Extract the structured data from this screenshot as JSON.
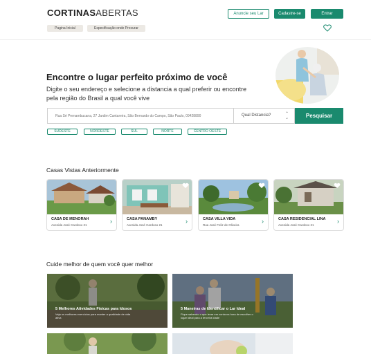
{
  "brand": {
    "bold": "CORTINAS",
    "light": "ABERTAS"
  },
  "header": {
    "announce_label": "Anuncie seu Lar",
    "signup_label": "Cadastre-se",
    "login_label": "Entrar",
    "breadcrumbs": [
      "Pagina Inicial",
      "Especificação onde Procurar"
    ]
  },
  "hero": {
    "title": "Encontre o lugar perfeito próximo de você",
    "subtitle": "Digite o seu endereço e selecione a distancia a qual preferir ou encontre pela região do Brasil a qual você vive"
  },
  "search": {
    "placeholder": "Rua Sé Pernambucana, 27 Jardim Cantareira, São Bernardo do Campo, São Paulo, 09428890",
    "distance_label": "Qual Distancia?",
    "button_label": "Pesquisar"
  },
  "regions": [
    "SUDESTE",
    "NORDESTE",
    "SUL",
    "NORTE",
    "CENTRO OESTE"
  ],
  "recent": {
    "title": "Casas Vistas Anteriormente",
    "cards": [
      {
        "name": "CASA DE MENORAH",
        "address": "Avenida José Cardoso 21"
      },
      {
        "name": "CASA PANAMBY",
        "address": "Avenida José Cardoso 21"
      },
      {
        "name": "CASA VILLA VIDA",
        "address": "Rua José Feliz de Oliveira"
      },
      {
        "name": "CASA RESIDENCIAL LINA",
        "address": "Avenida José Cardoso 21"
      }
    ]
  },
  "care": {
    "title": "Cuide melhor de quem você quer melhor",
    "articles": [
      {
        "title": "5 Melhores Atividades Físicas para Idosos",
        "desc": "Veja os melhores exercícios para manter a qualidade de vida ativa"
      },
      {
        "title": "5 Maneiras de Identificar o Lar Ideal",
        "desc": "Fique sabendo o que levar em conta na hora de escolher o lugar ideal para a terceira idade"
      }
    ]
  },
  "colors": {
    "accent": "#1a8a6e"
  }
}
